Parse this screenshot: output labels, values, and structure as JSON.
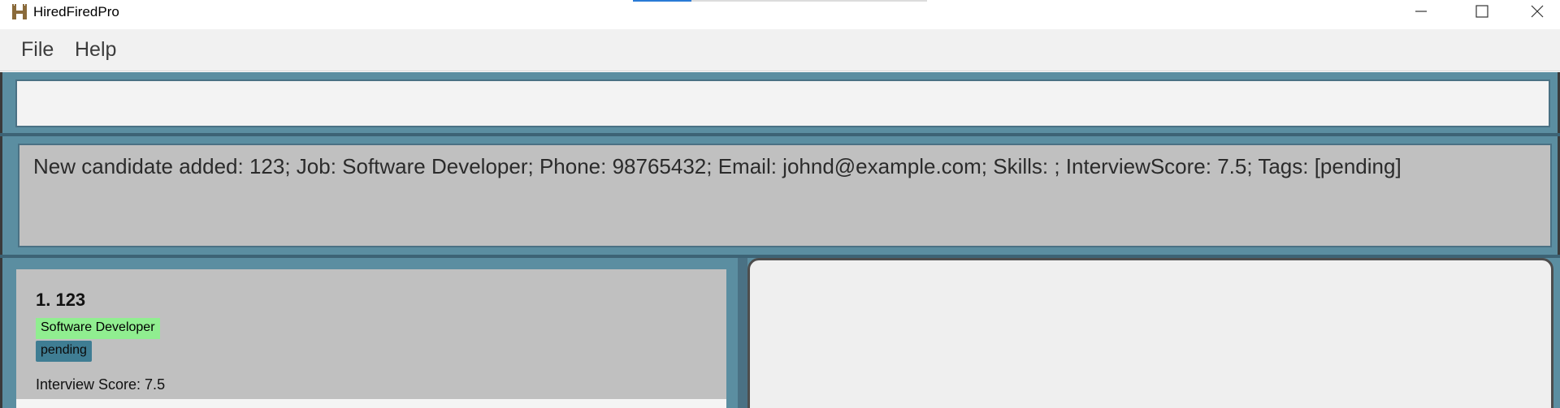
{
  "window": {
    "title": "HiredFiredPro",
    "app_icon": "castle-icon",
    "minimize_icon": "minimize-icon",
    "maximize_icon": "maximize-icon",
    "close_icon": "close-icon"
  },
  "menu": {
    "items": [
      {
        "label": "File"
      },
      {
        "label": "Help"
      }
    ]
  },
  "command_box": {
    "value": "",
    "placeholder": ""
  },
  "result_display": {
    "text": "New candidate added: 123; Job: Software Developer; Phone: 98765432; Email: johnd@example.com; Skills: ; InterviewScore: 7.5; Tags: [pending]"
  },
  "candidate_list": {
    "cards": [
      {
        "index_name": "1. 123",
        "job": "Software Developer",
        "tags": [
          "pending"
        ],
        "interview_score": "Interview Score: 7.5"
      }
    ]
  },
  "colors": {
    "panel_bg": "#5b8ea1",
    "card_bg": "#c0c0c0",
    "job_tag": "#90ee90",
    "status_tag": "#3f7d93"
  }
}
